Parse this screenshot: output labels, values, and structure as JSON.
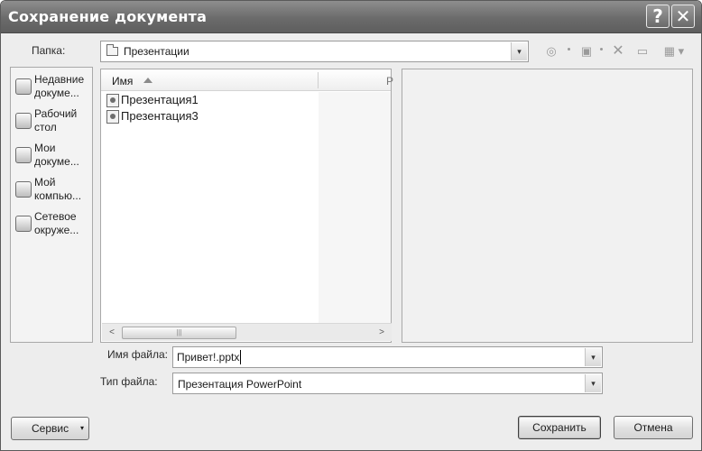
{
  "window": {
    "title": "Сохранение документа",
    "help_glyph": "?",
    "close_glyph": "✕"
  },
  "folder": {
    "label": "Папка:",
    "current": "Презентации",
    "dropdown_arrow": "▾"
  },
  "toolbar": {
    "icons": [
      "back-icon",
      "up-folder-icon",
      "delete-icon",
      "new-folder-icon",
      "views-icon"
    ]
  },
  "places": [
    {
      "label": "Недавние докуме...",
      "icon": "recent-documents-icon"
    },
    {
      "label": "Рабочий стол",
      "icon": "desktop-icon"
    },
    {
      "label": "Мои докуме...",
      "icon": "my-documents-icon"
    },
    {
      "label": "Мой компью...",
      "icon": "my-computer-icon"
    },
    {
      "label": "Сетевое окруже...",
      "icon": "network-icon"
    }
  ],
  "file_list": {
    "columns": [
      "Имя",
      "Р"
    ],
    "sort": "ascending",
    "items": [
      {
        "name": "Презентация1",
        "icon": "powerpoint-file-icon"
      },
      {
        "name": "Презентация3",
        "icon": "powerpoint-file-icon"
      }
    ],
    "scroll_thumb_grip": "|||",
    "scroll_left": "<",
    "scroll_right": ">"
  },
  "file_name": {
    "label": "Имя файла:",
    "value": "Привет!.pptx"
  },
  "file_type": {
    "label": "Тип файла:",
    "value": "Презентация PowerPoint"
  },
  "buttons": {
    "tools": "Сервис",
    "save": "Сохранить",
    "cancel": "Отмена"
  }
}
